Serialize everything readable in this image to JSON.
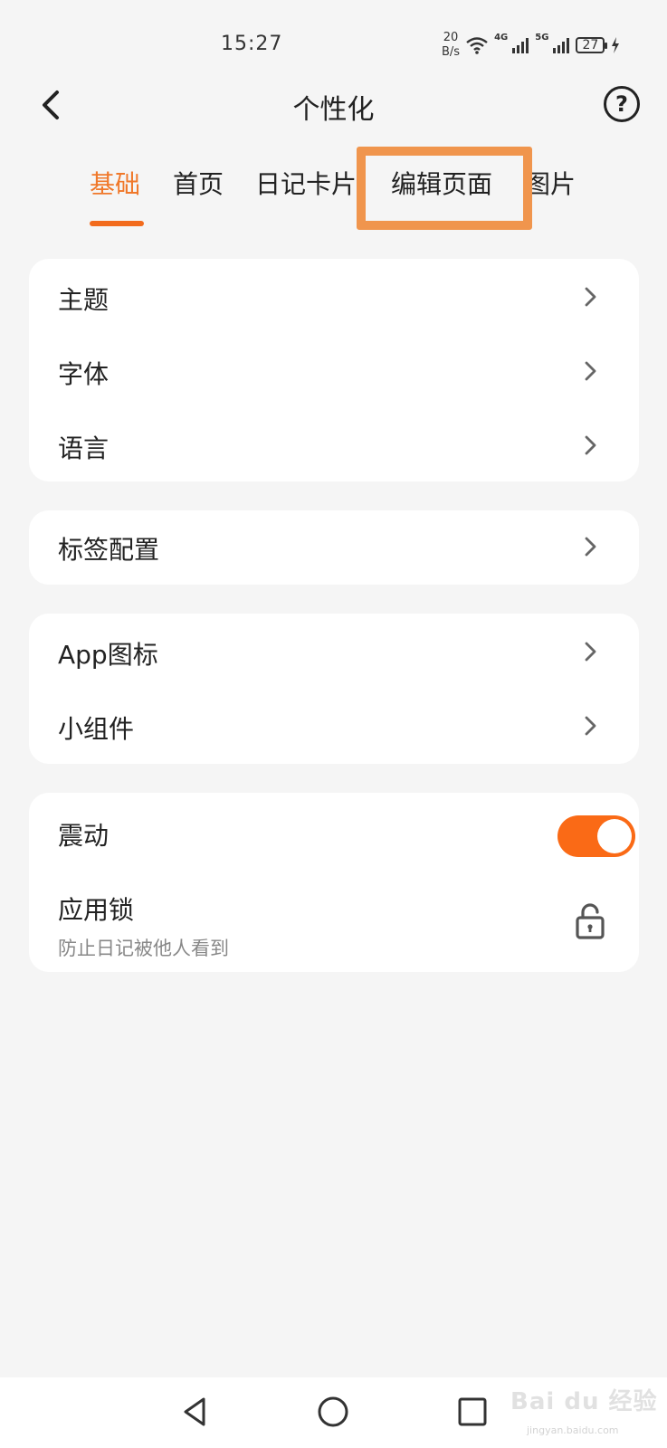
{
  "status_bar": {
    "time": "15:27",
    "net_speed_value": "20",
    "net_speed_unit": "B/s",
    "sig1_label": "4G",
    "sig2_label": "5G",
    "battery": "27"
  },
  "header": {
    "title": "个性化"
  },
  "tabs": [
    {
      "label": "基础",
      "active": true
    },
    {
      "label": "首页"
    },
    {
      "label": "日记卡片"
    },
    {
      "label": "编辑页面"
    },
    {
      "label": "图片"
    }
  ],
  "cards": {
    "basic": [
      {
        "label": "主题"
      },
      {
        "label": "字体"
      },
      {
        "label": "语言"
      }
    ],
    "tags": [
      {
        "label": "标签配置"
      }
    ],
    "app": [
      {
        "label": "App图标"
      },
      {
        "label": "小组件"
      }
    ],
    "security": {
      "vibration_label": "震动",
      "vibration_on": true,
      "applock_label": "应用锁",
      "applock_sub": "防止日记被他人看到"
    }
  },
  "watermark": {
    "text": "Bai du 经验",
    "sub": "jingyan.baidu.com"
  },
  "colors": {
    "accent": "#f26b1d",
    "highlight": "#f0954d",
    "background": "#f5f5f5"
  }
}
